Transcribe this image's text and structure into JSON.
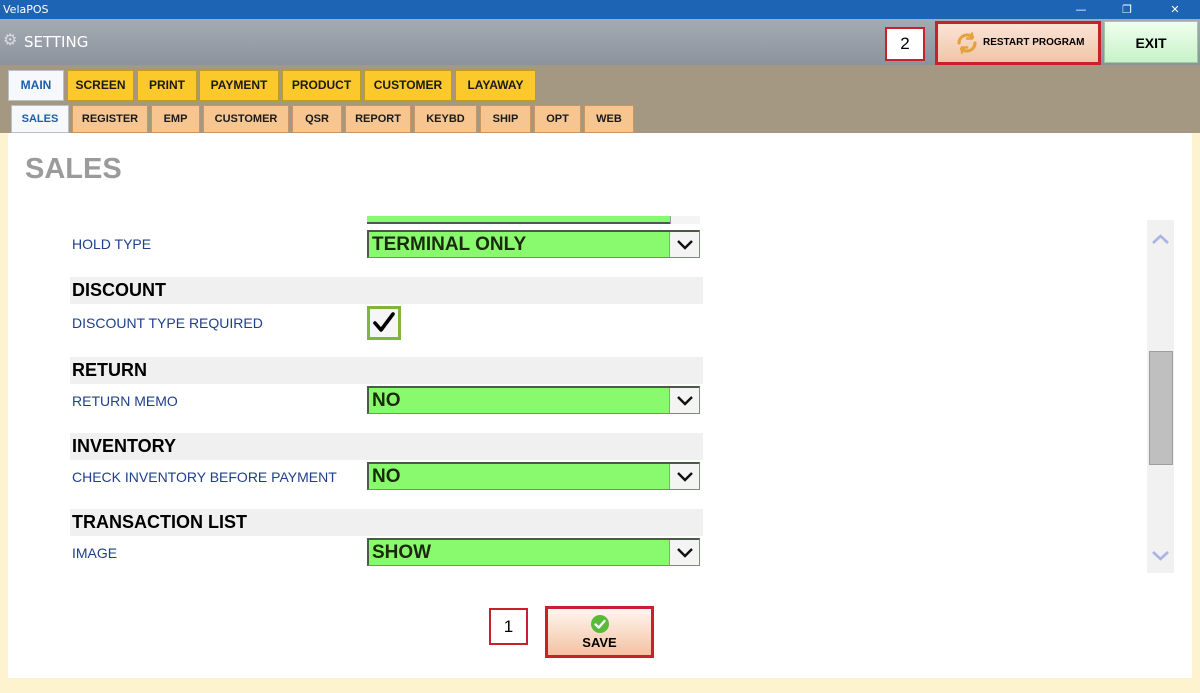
{
  "window": {
    "app_title": "VelaPOS",
    "minimize_glyph": "—",
    "maximize_glyph": "❐",
    "close_glyph": "✕"
  },
  "header": {
    "gear_icon": "gear-icon",
    "title": "SETTING",
    "step2": "2",
    "restart_label": "RESTART PROGRAM",
    "exit_label": "EXIT"
  },
  "main_tabs": [
    {
      "label": "MAIN",
      "active": true
    },
    {
      "label": "SCREEN"
    },
    {
      "label": "PRINT"
    },
    {
      "label": "PAYMENT"
    },
    {
      "label": "PRODUCT"
    },
    {
      "label": "CUSTOMER"
    },
    {
      "label": "LAYAWAY"
    }
  ],
  "sub_tabs": [
    {
      "label": "SALES",
      "active": true
    },
    {
      "label": "REGISTER"
    },
    {
      "label": "EMP"
    },
    {
      "label": "CUSTOMER"
    },
    {
      "label": "QSR"
    },
    {
      "label": "REPORT"
    },
    {
      "label": "KEYBD"
    },
    {
      "label": "SHIP"
    },
    {
      "label": "OPT"
    },
    {
      "label": "WEB"
    }
  ],
  "page": {
    "title": "SALES"
  },
  "settings": {
    "hold_type": {
      "label": "HOLD TYPE",
      "value": "TERMINAL ONLY"
    },
    "discount_section": "DISCOUNT",
    "discount_type_required": {
      "label": "DISCOUNT TYPE REQUIRED",
      "checked": true
    },
    "return_section": "RETURN",
    "return_memo": {
      "label": "RETURN MEMO",
      "value": "NO"
    },
    "inventory_section": "INVENTORY",
    "check_inventory": {
      "label": "CHECK INVENTORY BEFORE PAYMENT",
      "value": "NO"
    },
    "transaction_section": "TRANSACTION LIST",
    "image": {
      "label": "IMAGE",
      "value": "SHOW"
    }
  },
  "footer": {
    "step1": "1",
    "save_label": "SAVE"
  },
  "colors": {
    "accent_red": "#C8202C",
    "combo_green": "#89FA6E",
    "tab_yellow": "#FBC92C",
    "subtab_orange": "#F6C590",
    "titlebar_blue": "#1E64B4"
  }
}
